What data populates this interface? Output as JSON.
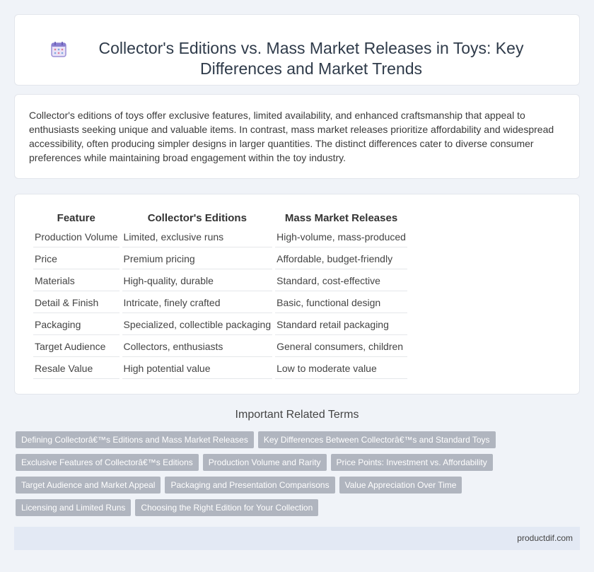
{
  "header": {
    "title": "Collector's Editions vs. Mass Market Releases in Toys: Key Differences and Market Trends"
  },
  "intro": {
    "text": "Collector's editions of toys offer exclusive features, limited availability, and enhanced craftsmanship that appeal to enthusiasts seeking unique and valuable items. In contrast, mass market releases prioritize affordability and widespread accessibility, often producing simpler designs in larger quantities. The distinct differences cater to diverse consumer preferences while maintaining broad engagement within the toy industry."
  },
  "table": {
    "headers": [
      "Feature",
      "Collector's Editions",
      "Mass Market Releases"
    ],
    "rows": [
      [
        "Production Volume",
        "Limited, exclusive runs",
        "High-volume, mass-produced"
      ],
      [
        "Price",
        "Premium pricing",
        "Affordable, budget-friendly"
      ],
      [
        "Materials",
        "High-quality, durable",
        "Standard, cost-effective"
      ],
      [
        "Detail & Finish",
        "Intricate, finely crafted",
        "Basic, functional design"
      ],
      [
        "Packaging",
        "Specialized, collectible packaging",
        "Standard retail packaging"
      ],
      [
        "Target Audience",
        "Collectors, enthusiasts",
        "General consumers, children"
      ],
      [
        "Resale Value",
        "High potential value",
        "Low to moderate value"
      ]
    ]
  },
  "related": {
    "title": "Important Related Terms",
    "tags": [
      "Defining Collectorâ€™s Editions and Mass Market Releases",
      "Key Differences Between Collectorâ€™s and Standard Toys",
      "Exclusive Features of Collectorâ€™s Editions",
      "Production Volume and Rarity",
      "Price Points: Investment vs. Affordability",
      "Target Audience and Market Appeal",
      "Packaging and Presentation Comparisons",
      "Value Appreciation Over Time",
      "Licensing and Limited Runs",
      "Choosing the Right Edition for Your Collection"
    ]
  },
  "footer": {
    "site": "productdif.com"
  }
}
